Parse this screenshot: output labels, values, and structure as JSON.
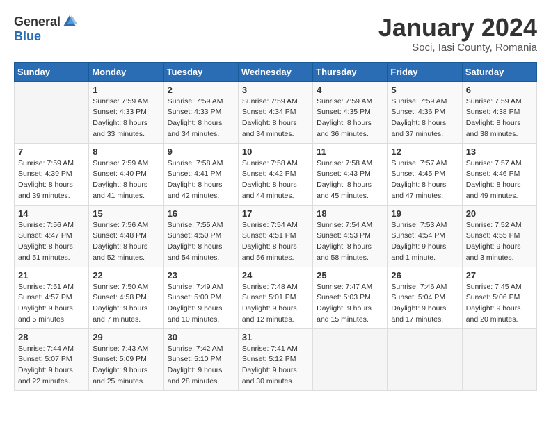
{
  "header": {
    "logo_general": "General",
    "logo_blue": "Blue",
    "month_title": "January 2024",
    "location": "Soci, Iasi County, Romania"
  },
  "days_of_week": [
    "Sunday",
    "Monday",
    "Tuesday",
    "Wednesday",
    "Thursday",
    "Friday",
    "Saturday"
  ],
  "weeks": [
    [
      {
        "day": "",
        "sunrise": "",
        "sunset": "",
        "daylight": ""
      },
      {
        "day": "1",
        "sunrise": "Sunrise: 7:59 AM",
        "sunset": "Sunset: 4:33 PM",
        "daylight": "Daylight: 8 hours and 33 minutes."
      },
      {
        "day": "2",
        "sunrise": "Sunrise: 7:59 AM",
        "sunset": "Sunset: 4:33 PM",
        "daylight": "Daylight: 8 hours and 34 minutes."
      },
      {
        "day": "3",
        "sunrise": "Sunrise: 7:59 AM",
        "sunset": "Sunset: 4:34 PM",
        "daylight": "Daylight: 8 hours and 34 minutes."
      },
      {
        "day": "4",
        "sunrise": "Sunrise: 7:59 AM",
        "sunset": "Sunset: 4:35 PM",
        "daylight": "Daylight: 8 hours and 36 minutes."
      },
      {
        "day": "5",
        "sunrise": "Sunrise: 7:59 AM",
        "sunset": "Sunset: 4:36 PM",
        "daylight": "Daylight: 8 hours and 37 minutes."
      },
      {
        "day": "6",
        "sunrise": "Sunrise: 7:59 AM",
        "sunset": "Sunset: 4:38 PM",
        "daylight": "Daylight: 8 hours and 38 minutes."
      }
    ],
    [
      {
        "day": "7",
        "sunrise": "Sunrise: 7:59 AM",
        "sunset": "Sunset: 4:39 PM",
        "daylight": "Daylight: 8 hours and 39 minutes."
      },
      {
        "day": "8",
        "sunrise": "Sunrise: 7:59 AM",
        "sunset": "Sunset: 4:40 PM",
        "daylight": "Daylight: 8 hours and 41 minutes."
      },
      {
        "day": "9",
        "sunrise": "Sunrise: 7:58 AM",
        "sunset": "Sunset: 4:41 PM",
        "daylight": "Daylight: 8 hours and 42 minutes."
      },
      {
        "day": "10",
        "sunrise": "Sunrise: 7:58 AM",
        "sunset": "Sunset: 4:42 PM",
        "daylight": "Daylight: 8 hours and 44 minutes."
      },
      {
        "day": "11",
        "sunrise": "Sunrise: 7:58 AM",
        "sunset": "Sunset: 4:43 PM",
        "daylight": "Daylight: 8 hours and 45 minutes."
      },
      {
        "day": "12",
        "sunrise": "Sunrise: 7:57 AM",
        "sunset": "Sunset: 4:45 PM",
        "daylight": "Daylight: 8 hours and 47 minutes."
      },
      {
        "day": "13",
        "sunrise": "Sunrise: 7:57 AM",
        "sunset": "Sunset: 4:46 PM",
        "daylight": "Daylight: 8 hours and 49 minutes."
      }
    ],
    [
      {
        "day": "14",
        "sunrise": "Sunrise: 7:56 AM",
        "sunset": "Sunset: 4:47 PM",
        "daylight": "Daylight: 8 hours and 51 minutes."
      },
      {
        "day": "15",
        "sunrise": "Sunrise: 7:56 AM",
        "sunset": "Sunset: 4:48 PM",
        "daylight": "Daylight: 8 hours and 52 minutes."
      },
      {
        "day": "16",
        "sunrise": "Sunrise: 7:55 AM",
        "sunset": "Sunset: 4:50 PM",
        "daylight": "Daylight: 8 hours and 54 minutes."
      },
      {
        "day": "17",
        "sunrise": "Sunrise: 7:54 AM",
        "sunset": "Sunset: 4:51 PM",
        "daylight": "Daylight: 8 hours and 56 minutes."
      },
      {
        "day": "18",
        "sunrise": "Sunrise: 7:54 AM",
        "sunset": "Sunset: 4:53 PM",
        "daylight": "Daylight: 8 hours and 58 minutes."
      },
      {
        "day": "19",
        "sunrise": "Sunrise: 7:53 AM",
        "sunset": "Sunset: 4:54 PM",
        "daylight": "Daylight: 9 hours and 1 minute."
      },
      {
        "day": "20",
        "sunrise": "Sunrise: 7:52 AM",
        "sunset": "Sunset: 4:55 PM",
        "daylight": "Daylight: 9 hours and 3 minutes."
      }
    ],
    [
      {
        "day": "21",
        "sunrise": "Sunrise: 7:51 AM",
        "sunset": "Sunset: 4:57 PM",
        "daylight": "Daylight: 9 hours and 5 minutes."
      },
      {
        "day": "22",
        "sunrise": "Sunrise: 7:50 AM",
        "sunset": "Sunset: 4:58 PM",
        "daylight": "Daylight: 9 hours and 7 minutes."
      },
      {
        "day": "23",
        "sunrise": "Sunrise: 7:49 AM",
        "sunset": "Sunset: 5:00 PM",
        "daylight": "Daylight: 9 hours and 10 minutes."
      },
      {
        "day": "24",
        "sunrise": "Sunrise: 7:48 AM",
        "sunset": "Sunset: 5:01 PM",
        "daylight": "Daylight: 9 hours and 12 minutes."
      },
      {
        "day": "25",
        "sunrise": "Sunrise: 7:47 AM",
        "sunset": "Sunset: 5:03 PM",
        "daylight": "Daylight: 9 hours and 15 minutes."
      },
      {
        "day": "26",
        "sunrise": "Sunrise: 7:46 AM",
        "sunset": "Sunset: 5:04 PM",
        "daylight": "Daylight: 9 hours and 17 minutes."
      },
      {
        "day": "27",
        "sunrise": "Sunrise: 7:45 AM",
        "sunset": "Sunset: 5:06 PM",
        "daylight": "Daylight: 9 hours and 20 minutes."
      }
    ],
    [
      {
        "day": "28",
        "sunrise": "Sunrise: 7:44 AM",
        "sunset": "Sunset: 5:07 PM",
        "daylight": "Daylight: 9 hours and 22 minutes."
      },
      {
        "day": "29",
        "sunrise": "Sunrise: 7:43 AM",
        "sunset": "Sunset: 5:09 PM",
        "daylight": "Daylight: 9 hours and 25 minutes."
      },
      {
        "day": "30",
        "sunrise": "Sunrise: 7:42 AM",
        "sunset": "Sunset: 5:10 PM",
        "daylight": "Daylight: 9 hours and 28 minutes."
      },
      {
        "day": "31",
        "sunrise": "Sunrise: 7:41 AM",
        "sunset": "Sunset: 5:12 PM",
        "daylight": "Daylight: 9 hours and 30 minutes."
      },
      {
        "day": "",
        "sunrise": "",
        "sunset": "",
        "daylight": ""
      },
      {
        "day": "",
        "sunrise": "",
        "sunset": "",
        "daylight": ""
      },
      {
        "day": "",
        "sunrise": "",
        "sunset": "",
        "daylight": ""
      }
    ]
  ]
}
